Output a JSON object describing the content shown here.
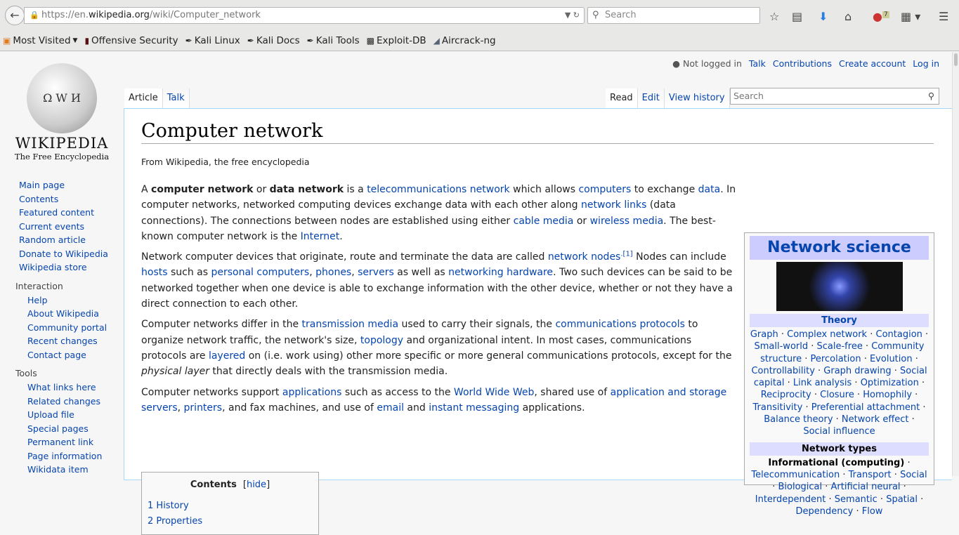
{
  "browser": {
    "url_host": "https://en.",
    "url_domain": "wikipedia.org",
    "url_path": "/wiki/Computer_network",
    "search_placeholder": "Search",
    "badge_count": "7",
    "bookmarks": [
      "Most Visited",
      "Offensive Security",
      "Kali Linux",
      "Kali Docs",
      "Kali Tools",
      "Exploit-DB",
      "Aircrack-ng"
    ]
  },
  "logo": {
    "wordmark": "Wikipedia",
    "tagline": "The Free Encyclopedia"
  },
  "sidebar": {
    "main": [
      "Main page",
      "Contents",
      "Featured content",
      "Current events",
      "Random article",
      "Donate to Wikipedia",
      "Wikipedia store"
    ],
    "interaction_title": "Interaction",
    "interaction": [
      "Help",
      "About Wikipedia",
      "Community portal",
      "Recent changes",
      "Contact page"
    ],
    "tools_title": "Tools",
    "tools": [
      "What links here",
      "Related changes",
      "Upload file",
      "Special pages",
      "Permanent link",
      "Page information",
      "Wikidata item"
    ]
  },
  "user": {
    "not_logged": "Not logged in",
    "links": [
      "Talk",
      "Contributions",
      "Create account",
      "Log in"
    ]
  },
  "tabs": {
    "left": [
      "Article",
      "Talk"
    ],
    "right": [
      "Read",
      "Edit",
      "View history"
    ],
    "search_placeholder": "Search"
  },
  "article": {
    "title": "Computer network",
    "from": "From Wikipedia, the free encyclopedia",
    "paragraphs": [
      [
        {
          "t": "A "
        },
        {
          "t": "computer network",
          "b": 1
        },
        {
          "t": " or "
        },
        {
          "t": "data network",
          "b": 1
        },
        {
          "t": " is a "
        },
        {
          "t": "telecommunications network",
          "l": 1
        },
        {
          "t": " which allows "
        },
        {
          "t": "computers",
          "l": 1
        },
        {
          "t": " to exchange "
        },
        {
          "t": "data",
          "l": 1
        },
        {
          "t": ". In computer networks, networked computing devices exchange data with each other along "
        },
        {
          "t": "network links",
          "l": 1
        },
        {
          "t": " (data connections). The connections between nodes are established using either "
        },
        {
          "t": "cable media",
          "l": 1
        },
        {
          "t": " or "
        },
        {
          "t": "wireless media",
          "l": 1
        },
        {
          "t": ". The best-known computer network is the "
        },
        {
          "t": "Internet",
          "l": 1
        },
        {
          "t": "."
        }
      ],
      [
        {
          "t": "Network computer devices that originate, route and terminate the data are called "
        },
        {
          "t": "network nodes",
          "l": 1
        },
        {
          "t": ".[1]",
          "l": 1,
          "s": 1
        },
        {
          "t": " Nodes can include "
        },
        {
          "t": "hosts",
          "l": 1
        },
        {
          "t": " such as "
        },
        {
          "t": "personal computers",
          "l": 1
        },
        {
          "t": ", "
        },
        {
          "t": "phones",
          "l": 1
        },
        {
          "t": ", "
        },
        {
          "t": "servers",
          "l": 1
        },
        {
          "t": " as well as "
        },
        {
          "t": "networking hardware",
          "l": 1
        },
        {
          "t": ". Two such devices can be said to be networked together when one device is able to exchange information with the other device, whether or not they have a direct connection to each other."
        }
      ],
      [
        {
          "t": "Computer networks differ in the "
        },
        {
          "t": "transmission media",
          "l": 1
        },
        {
          "t": " used to carry their signals, the "
        },
        {
          "t": "communications protocols",
          "l": 1
        },
        {
          "t": " to organize network traffic, the network's size, "
        },
        {
          "t": "topology",
          "l": 1
        },
        {
          "t": " and organizational intent. In most cases, communications protocols are "
        },
        {
          "t": "layered",
          "l": 1
        },
        {
          "t": " on (i.e. work using) other more specific or more general communications protocols, except for the "
        },
        {
          "t": "physical layer",
          "i": 1
        },
        {
          "t": " that directly deals with the transmission media."
        }
      ],
      [
        {
          "t": "Computer networks support "
        },
        {
          "t": "applications",
          "l": 1
        },
        {
          "t": " such as access to the "
        },
        {
          "t": "World Wide Web",
          "l": 1
        },
        {
          "t": ", shared use of "
        },
        {
          "t": "application and storage servers",
          "l": 1
        },
        {
          "t": ", "
        },
        {
          "t": "printers",
          "l": 1
        },
        {
          "t": ", and fax machines, and use of "
        },
        {
          "t": "email",
          "l": 1
        },
        {
          "t": " and "
        },
        {
          "t": "instant messaging",
          "l": 1
        },
        {
          "t": " applications."
        }
      ]
    ]
  },
  "toc": {
    "title": "Contents",
    "hide": "hide",
    "items": [
      {
        "num": "1",
        "label": "History"
      },
      {
        "num": "2",
        "label": "Properties"
      }
    ]
  },
  "infobox": {
    "title": "Network science",
    "theory_title": "Theory",
    "theory": [
      "Graph",
      "Complex network",
      "Contagion",
      "Small-world",
      "Scale-free",
      "Community structure",
      "Percolation",
      "Evolution",
      "Controllability",
      "Graph drawing",
      "Social capital",
      "Link analysis",
      "Optimization",
      "Reciprocity",
      "Closure",
      "Homophily",
      "Transitivity",
      "Preferential attachment",
      "Balance theory",
      "Network effect",
      "Social influence"
    ],
    "types_title": "Network types",
    "types_bold": "Informational (computing)",
    "types": [
      "Telecommunication",
      "Transport",
      "Social",
      "Biological",
      "Artificial neural",
      "Interdependent",
      "Semantic",
      "Spatial",
      "Dependency",
      "Flow"
    ]
  },
  "colors": {
    "link": "#0645ad",
    "infobox_header": "#ccccff"
  }
}
